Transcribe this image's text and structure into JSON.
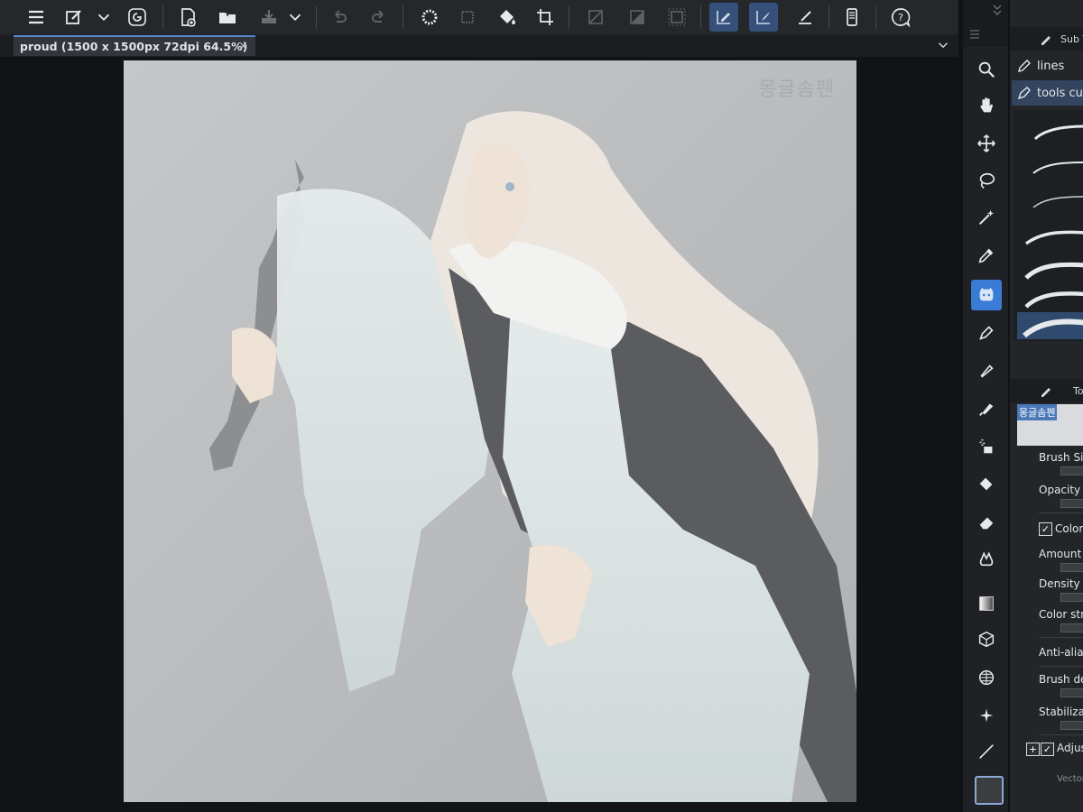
{
  "window": {
    "document_tab": "proud (1500 x 1500px 72dpi 64.5%)",
    "tab_close": "×"
  },
  "toolbar": {
    "buttons": [
      {
        "name": "menu-icon"
      },
      {
        "name": "quick-access-icon"
      },
      {
        "name": "chevron-down-icon"
      },
      {
        "name": "spiral-icon"
      },
      {
        "name": "new-file-icon"
      },
      {
        "name": "open-folder-icon"
      },
      {
        "name": "save-icon"
      },
      {
        "name": "chevron-down-icon"
      },
      {
        "name": "undo-icon"
      },
      {
        "name": "redo-icon"
      },
      {
        "name": "loading-icon"
      },
      {
        "name": "layer-icon"
      },
      {
        "name": "fill-icon"
      },
      {
        "name": "crop-icon"
      },
      {
        "name": "hide-selection-icon"
      },
      {
        "name": "invert-icon"
      },
      {
        "name": "transform-icon"
      },
      {
        "name": "stroke-pen-icon"
      },
      {
        "name": "stroke-brush-icon"
      },
      {
        "name": "stroke-line-icon"
      },
      {
        "name": "smartphone-icon"
      },
      {
        "name": "help-icon"
      }
    ]
  },
  "canvas": {
    "signature": "몽글솜펜",
    "background": "#b9bbbd"
  },
  "tools": {
    "items": [
      {
        "name": "zoom-icon"
      },
      {
        "name": "hand-icon"
      },
      {
        "name": "move-icon"
      },
      {
        "name": "lasso-icon"
      },
      {
        "name": "magic-wand-icon"
      },
      {
        "name": "eyedropper-icon"
      },
      {
        "name": "pen-tool-icon",
        "selected": true
      },
      {
        "name": "pencil-icon"
      },
      {
        "name": "brush-icon"
      },
      {
        "name": "airbrush-icon"
      },
      {
        "name": "decoration-icon"
      },
      {
        "name": "fill-bucket-icon"
      },
      {
        "name": "eraser-icon"
      },
      {
        "name": "blend-icon"
      },
      {
        "name": "gradient-icon"
      },
      {
        "name": "3d-object-icon"
      },
      {
        "name": "frame-grid-icon"
      },
      {
        "name": "sparkle-icon"
      },
      {
        "name": "line-icon"
      }
    ],
    "accent": "#3a7bd5"
  },
  "sub_tool": {
    "header": "Sub T",
    "items": [
      {
        "label": "lines",
        "selected": false
      },
      {
        "label": "tools cum",
        "selected": true
      }
    ]
  },
  "tool_property": {
    "header": "To",
    "preset_label": "몽글솜펜",
    "rows": [
      {
        "label": "Brush Siz"
      },
      {
        "label": "Opacity"
      },
      {
        "label": "Color t"
      },
      {
        "label": "Amount c"
      },
      {
        "label": "Density c"
      },
      {
        "label": "Color stre"
      },
      {
        "label": "Anti-aliasi"
      },
      {
        "label": "Brush de"
      },
      {
        "label": "Stabiliza"
      },
      {
        "label": "Adjus"
      }
    ],
    "footer": "Vector"
  }
}
